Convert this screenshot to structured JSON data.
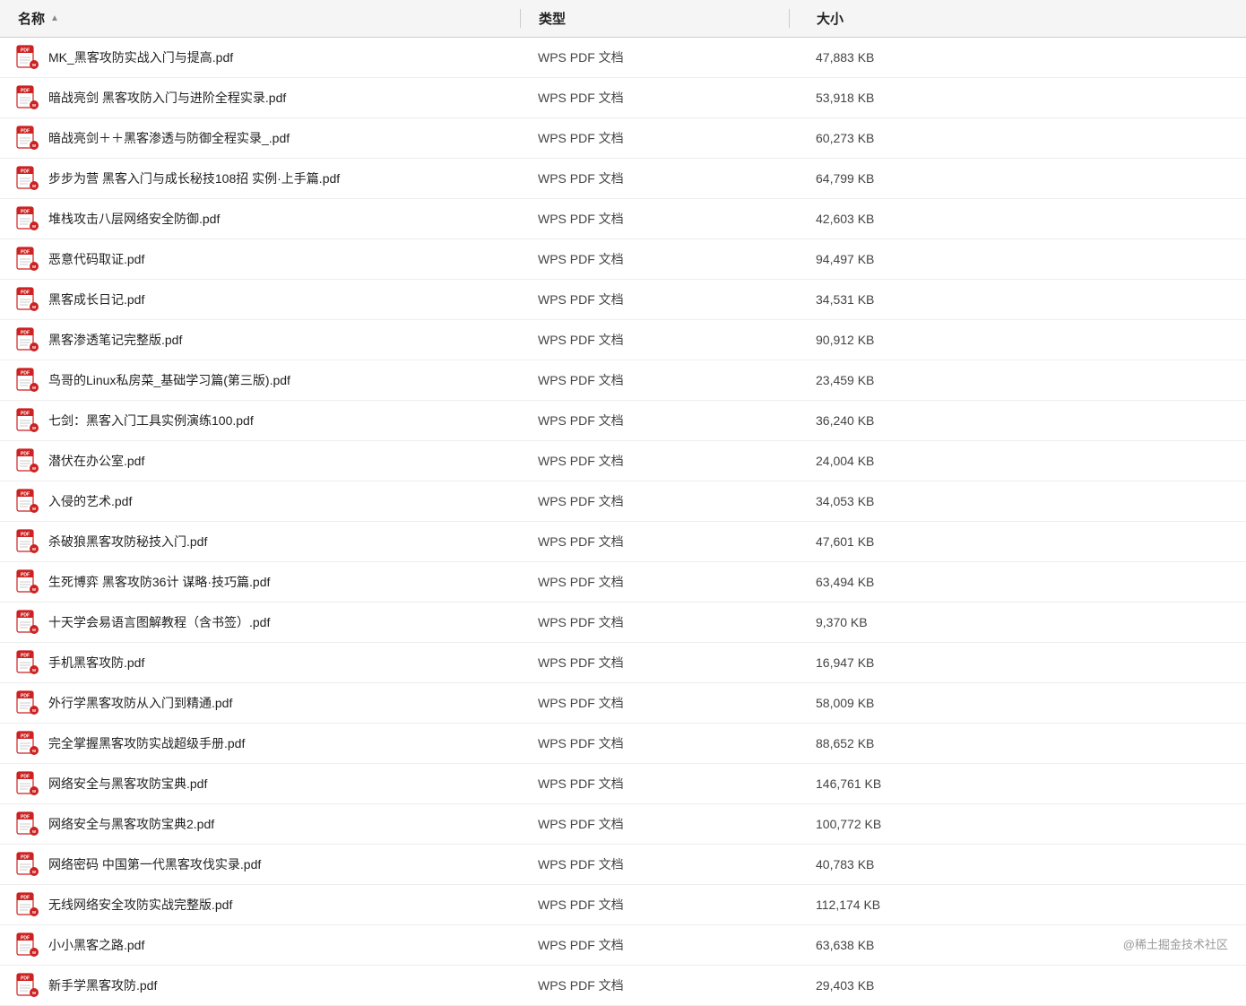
{
  "header": {
    "col_name": "名称",
    "col_type": "类型",
    "col_size": "大小",
    "sort_arrow": "▲"
  },
  "files": [
    {
      "name": "MK_黑客攻防实战入门与提高.pdf",
      "type": "WPS PDF 文档",
      "size": "47,883 KB"
    },
    {
      "name": "暗战亮剑 黑客攻防入门与进阶全程实录.pdf",
      "type": "WPS PDF 文档",
      "size": "53,918 KB"
    },
    {
      "name": "暗战亮剑＋＋黑客渗透与防御全程实录_.pdf",
      "type": "WPS PDF 文档",
      "size": "60,273 KB"
    },
    {
      "name": "步步为营 黑客入门与成长秘技108招 实例·上手篇.pdf",
      "type": "WPS PDF 文档",
      "size": "64,799 KB"
    },
    {
      "name": "堆栈攻击八层网络安全防御.pdf",
      "type": "WPS PDF 文档",
      "size": "42,603 KB"
    },
    {
      "name": "恶意代码取证.pdf",
      "type": "WPS PDF 文档",
      "size": "94,497 KB"
    },
    {
      "name": "黑客成长日记.pdf",
      "type": "WPS PDF 文档",
      "size": "34,531 KB"
    },
    {
      "name": "黑客渗透笔记完整版.pdf",
      "type": "WPS PDF 文档",
      "size": "90,912 KB"
    },
    {
      "name": "鸟哥的Linux私房菜_基础学习篇(第三版).pdf",
      "type": "WPS PDF 文档",
      "size": "23,459 KB"
    },
    {
      "name": "七剑：黑客入门工具实例演练100.pdf",
      "type": "WPS PDF 文档",
      "size": "36,240 KB"
    },
    {
      "name": "潜伏在办公室.pdf",
      "type": "WPS PDF 文档",
      "size": "24,004 KB"
    },
    {
      "name": "入侵的艺术.pdf",
      "type": "WPS PDF 文档",
      "size": "34,053 KB"
    },
    {
      "name": "杀破狼黑客攻防秘技入门.pdf",
      "type": "WPS PDF 文档",
      "size": "47,601 KB"
    },
    {
      "name": "生死博弈 黑客攻防36计 谋略·技巧篇.pdf",
      "type": "WPS PDF 文档",
      "size": "63,494 KB"
    },
    {
      "name": "十天学会易语言图解教程（含书签）.pdf",
      "type": "WPS PDF 文档",
      "size": "9,370 KB"
    },
    {
      "name": "手机黑客攻防.pdf",
      "type": "WPS PDF 文档",
      "size": "16,947 KB"
    },
    {
      "name": "外行学黑客攻防从入门到精通.pdf",
      "type": "WPS PDF 文档",
      "size": "58,009 KB"
    },
    {
      "name": "完全掌握黑客攻防实战超级手册.pdf",
      "type": "WPS PDF 文档",
      "size": "88,652 KB"
    },
    {
      "name": "网络安全与黑客攻防宝典.pdf",
      "type": "WPS PDF 文档",
      "size": "146,761 KB"
    },
    {
      "name": "网络安全与黑客攻防宝典2.pdf",
      "type": "WPS PDF 文档",
      "size": "100,772 KB"
    },
    {
      "name": "网络密码 中国第一代黑客攻伐实录.pdf",
      "type": "WPS PDF 文档",
      "size": "40,783 KB"
    },
    {
      "name": "无线网络安全攻防实战完整版.pdf",
      "type": "WPS PDF 文档",
      "size": "112,174 KB"
    },
    {
      "name": "小小黑客之路.pdf",
      "type": "WPS PDF 文档",
      "size": "63,638 KB"
    },
    {
      "name": "新手学黑客攻防.pdf",
      "type": "WPS PDF 文档",
      "size": "29,403 KB"
    }
  ],
  "watermark": "@稀土掘金技术社区"
}
